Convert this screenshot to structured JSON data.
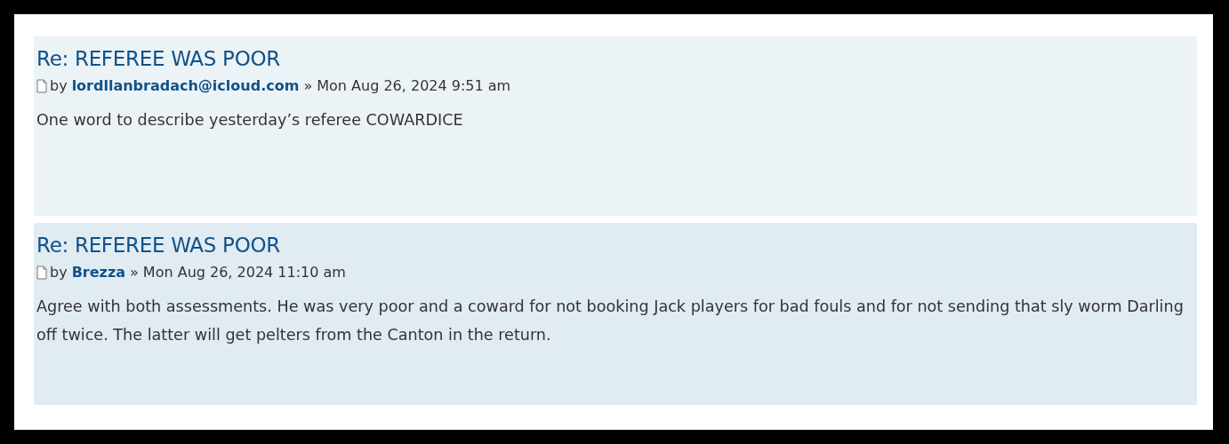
{
  "posts": [
    {
      "title": "Re: REFEREE WAS POOR",
      "by": "by",
      "author": "lordllanbradach@icloud.com",
      "separator": "»",
      "date": "Mon Aug 26, 2024 9:51 am",
      "content": [
        "One word to describe yesterday’s referee COWARDICE"
      ]
    },
    {
      "title": "Re: REFEREE WAS POOR",
      "by": "by",
      "author": "Brezza",
      "separator": "»",
      "date": "Mon Aug 26, 2024 11:10 am",
      "content": [
        "Agree with both assessments. He was very poor and a coward for not booking Jack players for bad fouls and for not sending that sly worm Darling off twice. The latter will get pelters from the Canton in the return."
      ]
    }
  ]
}
